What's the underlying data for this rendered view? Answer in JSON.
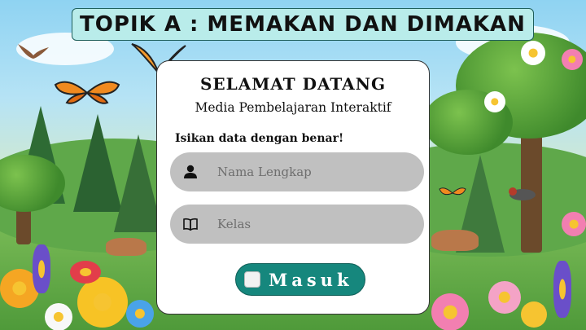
{
  "title": "TOPIK A : MEMAKAN DAN DIMAKAN",
  "card": {
    "welcome": "SELAMAT DATANG",
    "subtitle": "Media Pembelajaran Interaktif",
    "instruction": "Isikan data dengan benar!"
  },
  "form": {
    "name_placeholder": "Nama Lengkap",
    "name_value": "",
    "class_placeholder": "Kelas",
    "class_value": "",
    "submit_label": "Masuk"
  },
  "icons": {
    "name_field": "user-icon",
    "class_field": "book-icon",
    "submit": "checkbox-icon"
  },
  "colors": {
    "title_bg": "#b9ecea",
    "field_bg": "#c0c0c0",
    "button_bg": "#16877d"
  }
}
